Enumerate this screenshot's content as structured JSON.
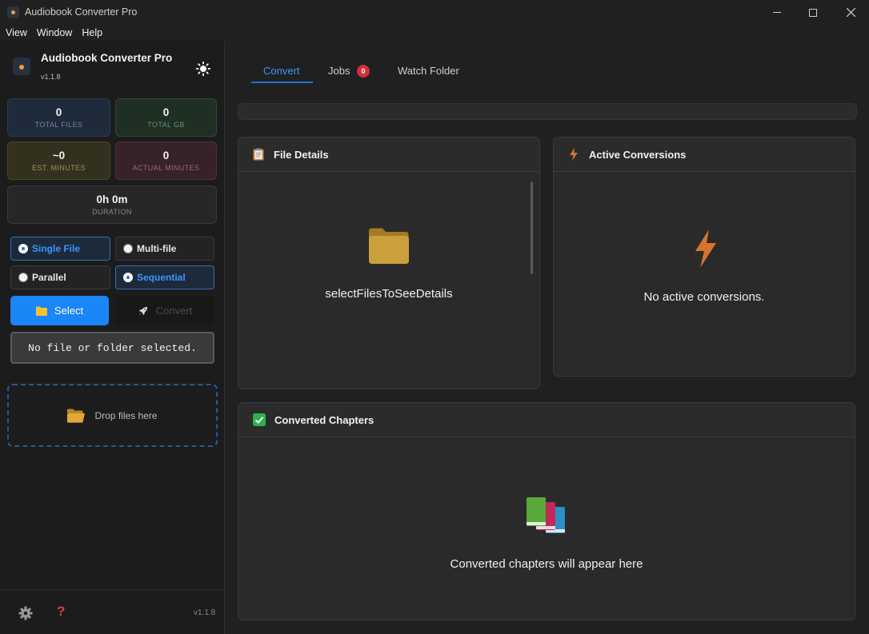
{
  "window": {
    "title": "Audiobook Converter Pro"
  },
  "menu": {
    "items": [
      "View",
      "Window",
      "Help"
    ]
  },
  "sidebar": {
    "brand_name": "Audiobook Converter Pro",
    "brand_version": "v1.1.8",
    "stats": {
      "total_files": {
        "value": "0",
        "label": "TOTAL FILES"
      },
      "total_gb": {
        "value": "0",
        "label": "TOTAL GB"
      },
      "est_minutes": {
        "value": "~0",
        "label": "EST. MINUTES"
      },
      "actual_minutes": {
        "value": "0",
        "label": "ACTUAL MINUTES"
      },
      "duration": {
        "value": "0h 0m",
        "label": "DURATION"
      }
    },
    "modes": {
      "single": {
        "label": "Single File",
        "selected": true
      },
      "multi": {
        "label": "Multi-file",
        "selected": false
      },
      "parallel": {
        "label": "Parallel",
        "selected": false
      },
      "sequential": {
        "label": "Sequential",
        "selected": true
      }
    },
    "select_label": "Select",
    "convert_label": "Convert",
    "status_text": "No file or folder selected.",
    "dropzone_text": "Drop files here",
    "footer_version": "v1.1.8"
  },
  "tabs": {
    "convert": "Convert",
    "jobs": "Jobs",
    "jobs_count": "0",
    "watch": "Watch Folder"
  },
  "panels": {
    "file_details": {
      "title": "File Details",
      "message": "selectFilesToSeeDetails"
    },
    "active_conversions": {
      "title": "Active Conversions",
      "message": "No active conversions."
    },
    "converted_chapters": {
      "title": "Converted Chapters",
      "message": "Converted chapters will appear here"
    }
  },
  "colors": {
    "accent": "#1b86f5",
    "jobs_badge": "#d42e3a",
    "help_icon": "#e53945"
  }
}
